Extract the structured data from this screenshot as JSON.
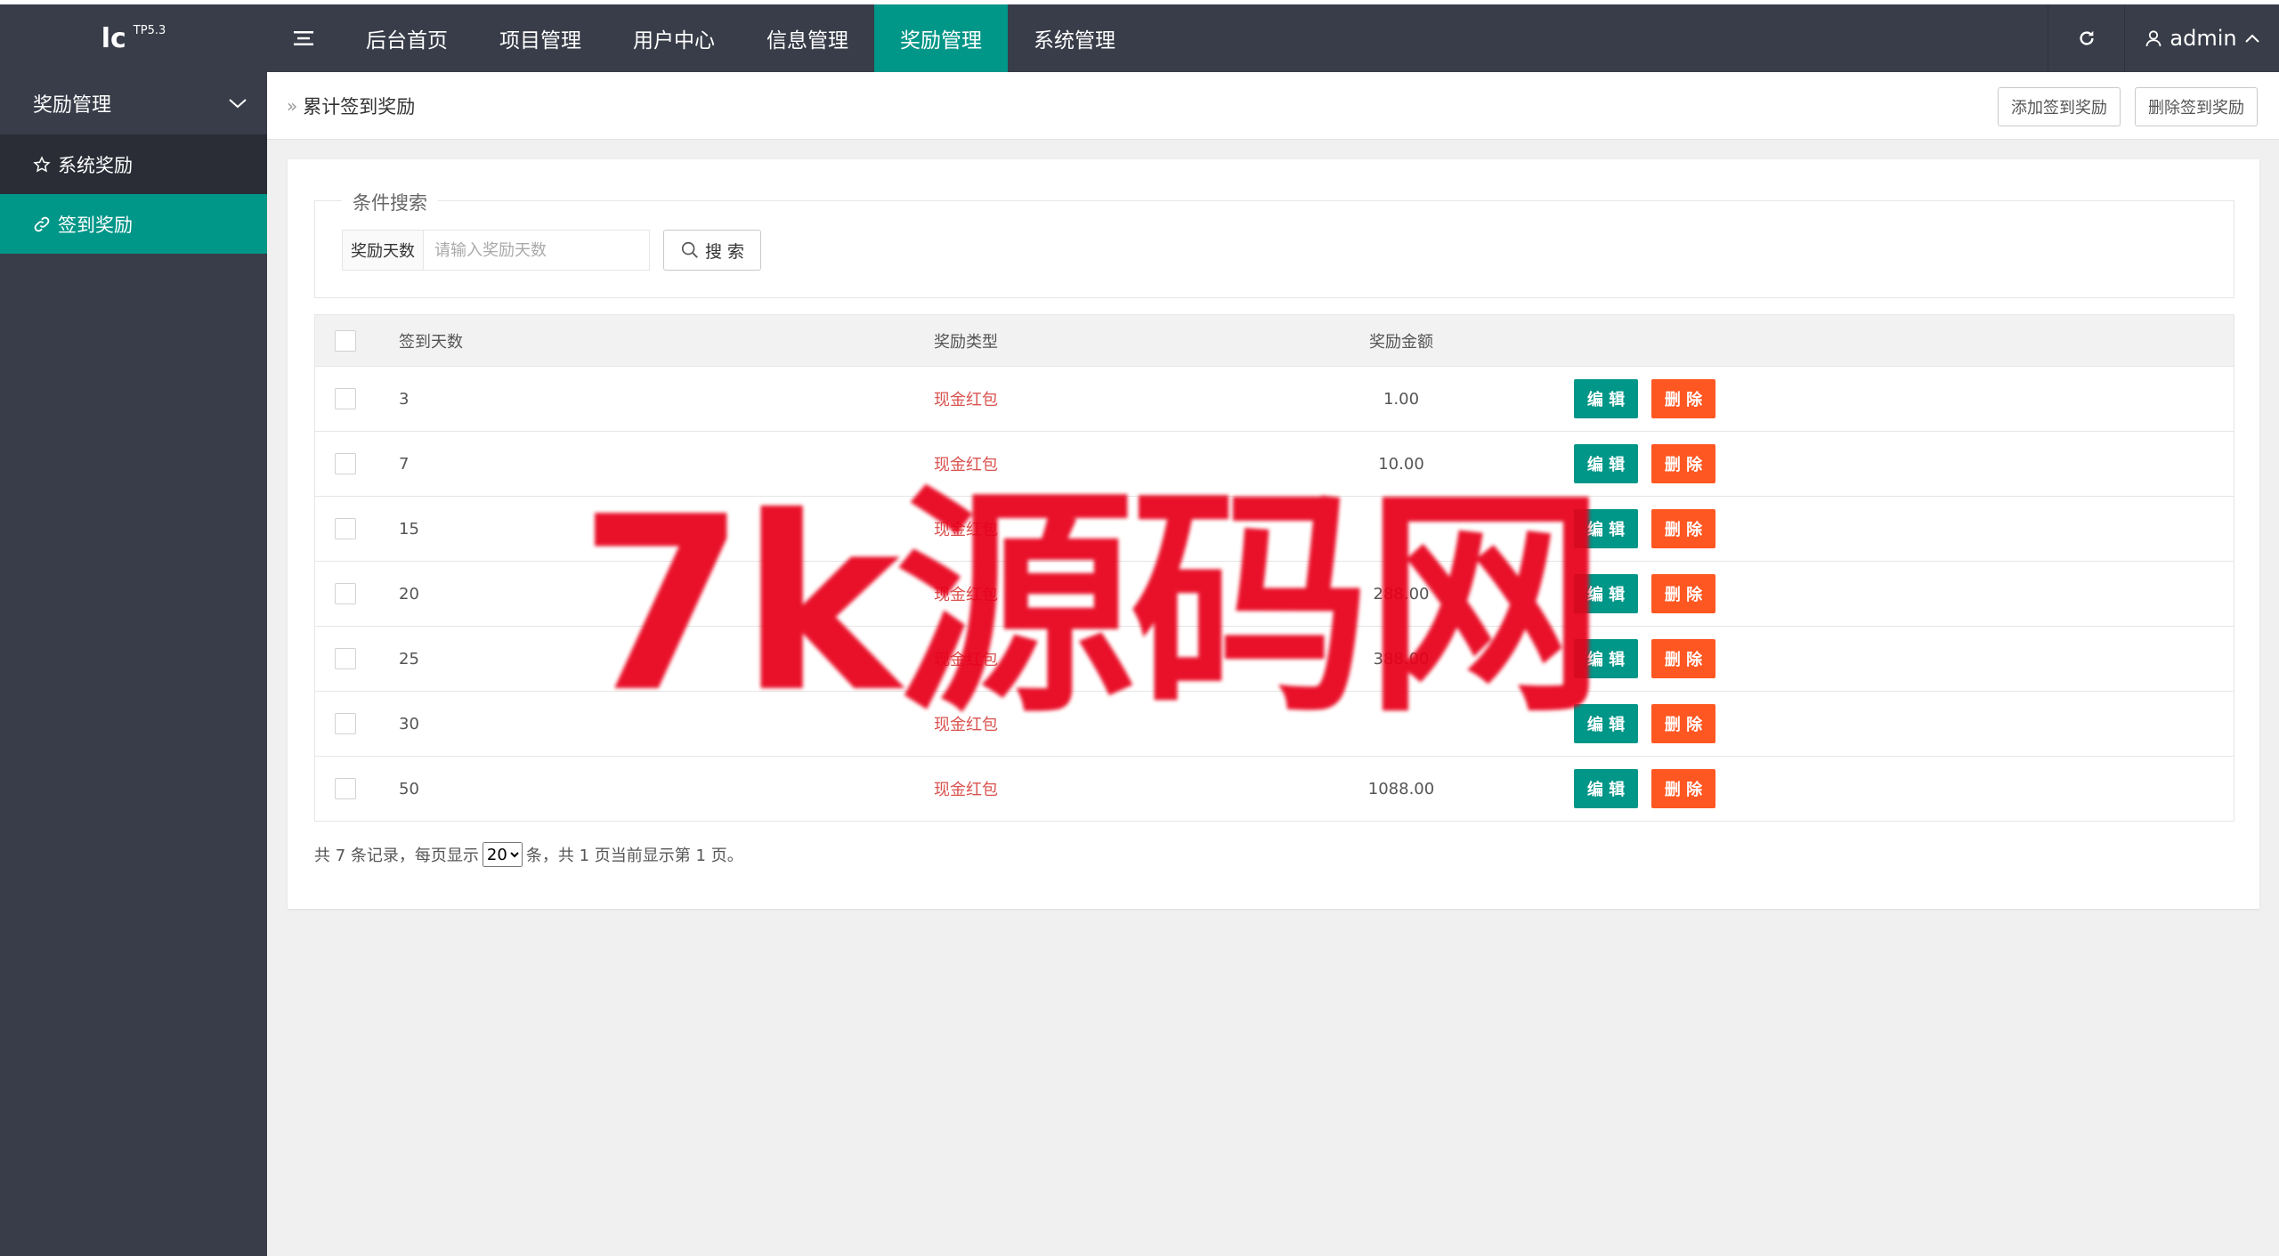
{
  "header": {
    "logo_main": "lc",
    "logo_version": "TP5.3",
    "nav": [
      {
        "label": "后台首页"
      },
      {
        "label": "项目管理"
      },
      {
        "label": "用户中心"
      },
      {
        "label": "信息管理"
      },
      {
        "label": "奖励管理",
        "active": true
      },
      {
        "label": "系统管理"
      }
    ],
    "user_name": "admin"
  },
  "sidebar": {
    "group_label": "奖励管理",
    "items": [
      {
        "label": "系统奖励",
        "icon": "star-icon"
      },
      {
        "label": "签到奖励",
        "icon": "link-icon",
        "active": true
      }
    ]
  },
  "breadcrumb": {
    "current": "累计签到奖励"
  },
  "toolbar": {
    "add_label": "添加签到奖励",
    "delete_label": "删除签到奖励"
  },
  "search": {
    "legend": "条件搜索",
    "field_label": "奖励天数",
    "placeholder": "请输入奖励天数",
    "button_label": "搜 索"
  },
  "table": {
    "headers": {
      "days": "签到天数",
      "type": "奖励类型",
      "amount": "奖励金额"
    },
    "edit_label": "编 辑",
    "delete_label": "删 除",
    "rows": [
      {
        "days": "3",
        "type": "现金红包",
        "amount": "1.00"
      },
      {
        "days": "7",
        "type": "现金红包",
        "amount": "10.00"
      },
      {
        "days": "15",
        "type": "现金红包",
        "amount": ""
      },
      {
        "days": "20",
        "type": "现金红包",
        "amount": "288.00"
      },
      {
        "days": "25",
        "type": "现金红包",
        "amount": "388.00"
      },
      {
        "days": "30",
        "type": "现金红包",
        "amount": ""
      },
      {
        "days": "50",
        "type": "现金红包",
        "amount": "1088.00"
      }
    ]
  },
  "pagination": {
    "prefix": "共 7 条记录，每页显示",
    "page_size": "20",
    "suffix": "条，共 1 页当前显示第 1 页。"
  },
  "watermark": {
    "text": "7k源码网"
  },
  "colors": {
    "header_bg": "#393d49",
    "accent": "#009688",
    "danger": "#ff5722",
    "type_text": "#d9534f"
  }
}
